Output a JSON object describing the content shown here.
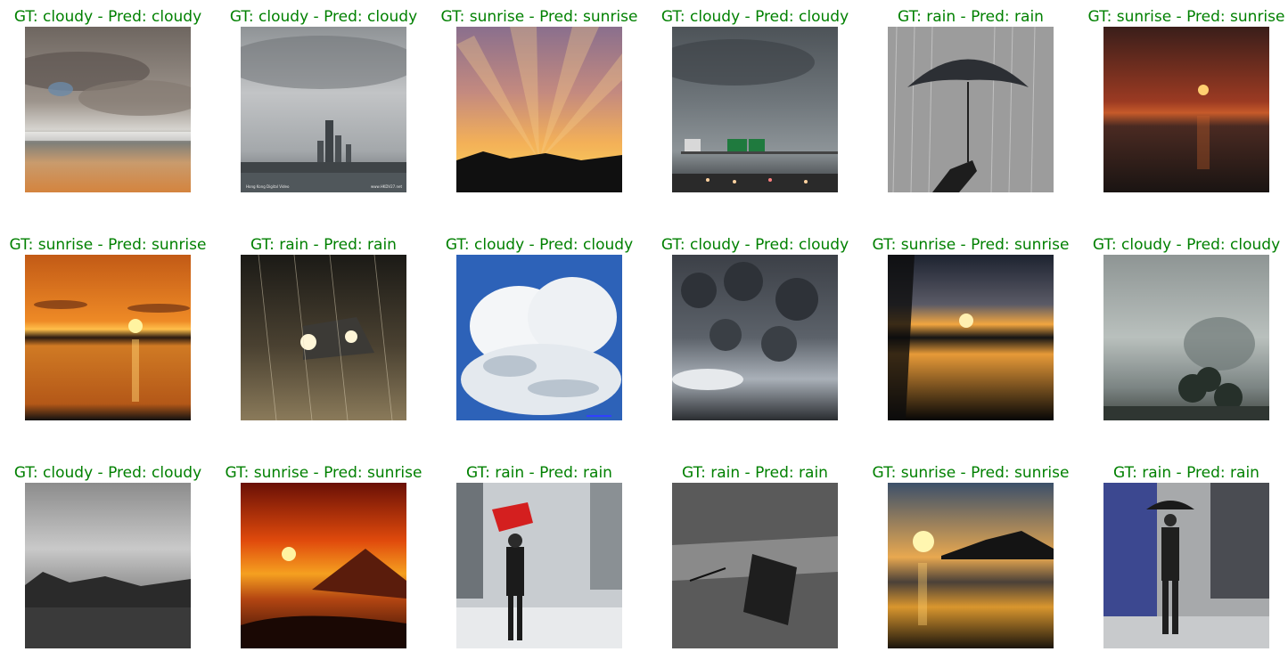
{
  "grid": {
    "caption_color": "#008000",
    "rows": [
      [
        {
          "caption": "GT: cloudy - Pred: cloudy",
          "scene": "cloudy-beach"
        },
        {
          "caption": "GT: cloudy - Pred: cloudy",
          "scene": "cloudy-city",
          "watermark_left": "Hong Kong Digital Video",
          "watermark_right": "www.HKDV27.net"
        },
        {
          "caption": "GT: sunrise - Pred: sunrise",
          "scene": "sunrise-rays"
        },
        {
          "caption": "GT: cloudy - Pred: cloudy",
          "scene": "cloudy-highway"
        },
        {
          "caption": "GT: rain - Pred: rain",
          "scene": "rain-umbrella-hand"
        },
        {
          "caption": "GT: sunrise - Pred: sunrise",
          "scene": "sunrise-sea-dark"
        }
      ],
      [
        {
          "caption": "GT: sunrise - Pred: sunrise",
          "scene": "sunrise-orange-lake"
        },
        {
          "caption": "GT: rain - Pred: rain",
          "scene": "rain-car-night"
        },
        {
          "caption": "GT: cloudy - Pred: cloudy",
          "scene": "cloudy-white-cumulus"
        },
        {
          "caption": "GT: cloudy - Pred: cloudy",
          "scene": "cloudy-dark-mammatus"
        },
        {
          "caption": "GT: sunrise - Pred: sunrise",
          "scene": "sunrise-reflection"
        },
        {
          "caption": "GT: cloudy - Pred: cloudy",
          "scene": "cloudy-gray-tree"
        }
      ],
      [
        {
          "caption": "GT: cloudy - Pred: cloudy",
          "scene": "cloudy-bw-landscape"
        },
        {
          "caption": "GT: sunrise - Pred: sunrise",
          "scene": "sunrise-mountain-red"
        },
        {
          "caption": "GT: rain - Pred: rain",
          "scene": "rain-red-umbrella"
        },
        {
          "caption": "GT: rain - Pred: rain",
          "scene": "rain-dropped-umbrella"
        },
        {
          "caption": "GT: sunrise - Pred: sunrise",
          "scene": "sunrise-beach"
        },
        {
          "caption": "GT: rain - Pred: rain",
          "scene": "rain-man-umbrella"
        }
      ]
    ]
  }
}
